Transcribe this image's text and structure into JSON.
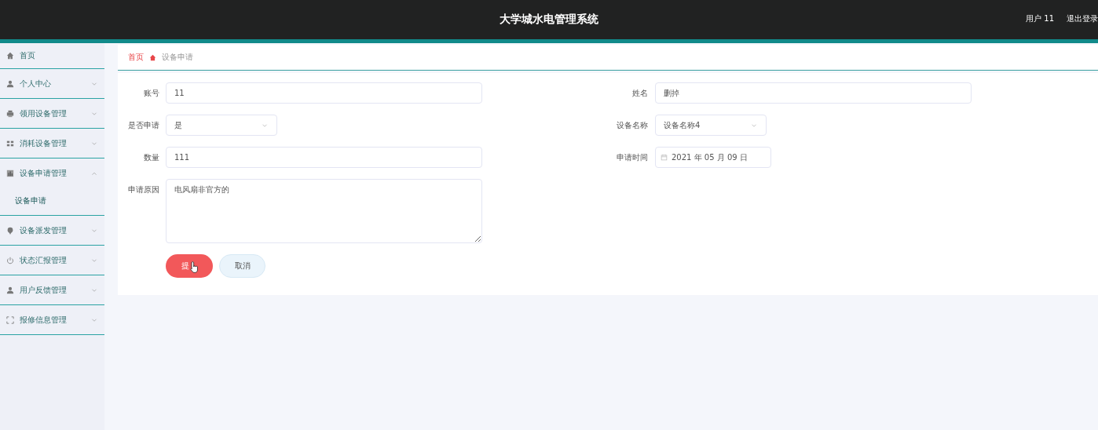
{
  "header": {
    "title": "大学城水电管理系统",
    "user": "用户 11",
    "logout": "退出登录"
  },
  "sidebar": {
    "items": [
      {
        "label": "首页",
        "kind": "home"
      },
      {
        "label": "个人中心",
        "kind": "person",
        "expanded": false
      },
      {
        "label": "领用设备管理",
        "kind": "printer",
        "expanded": false
      },
      {
        "label": "消耗设备管理",
        "kind": "grid",
        "expanded": false
      },
      {
        "label": "设备申请管理",
        "kind": "chart",
        "expanded": true,
        "children": [
          {
            "label": "设备申请",
            "selected": true
          }
        ]
      },
      {
        "label": "设备派发管理",
        "kind": "pin",
        "expanded": false
      },
      {
        "label": "状态汇报管理",
        "kind": "power",
        "expanded": false
      },
      {
        "label": "用户反馈管理",
        "kind": "person",
        "expanded": false
      },
      {
        "label": "报修信息管理",
        "kind": "frame",
        "expanded": false
      }
    ]
  },
  "breadcrumb": [
    {
      "label": "首页",
      "kind": "link"
    },
    {
      "label": "设备申请",
      "kind": "current"
    }
  ],
  "form": {
    "fields": [
      {
        "label": "账号",
        "kind": "text",
        "value": "11"
      },
      {
        "label": "姓名",
        "kind": "text",
        "value": "删掉"
      },
      {
        "label": "是否申请",
        "kind": "select",
        "value": "是"
      },
      {
        "label": "设备名称",
        "kind": "select",
        "value": "设备名称4"
      },
      {
        "label": "数量",
        "kind": "text",
        "value": "111"
      },
      {
        "label": "申请时间",
        "kind": "date",
        "value": "2021 年 05 月 09 日"
      },
      {
        "label": "申请原因",
        "kind": "textarea",
        "value": "电风扇非官方的"
      }
    ],
    "buttons": [
      {
        "label": "提",
        "kind": "primary"
      },
      {
        "label": "取消",
        "kind": "secondary"
      }
    ]
  }
}
